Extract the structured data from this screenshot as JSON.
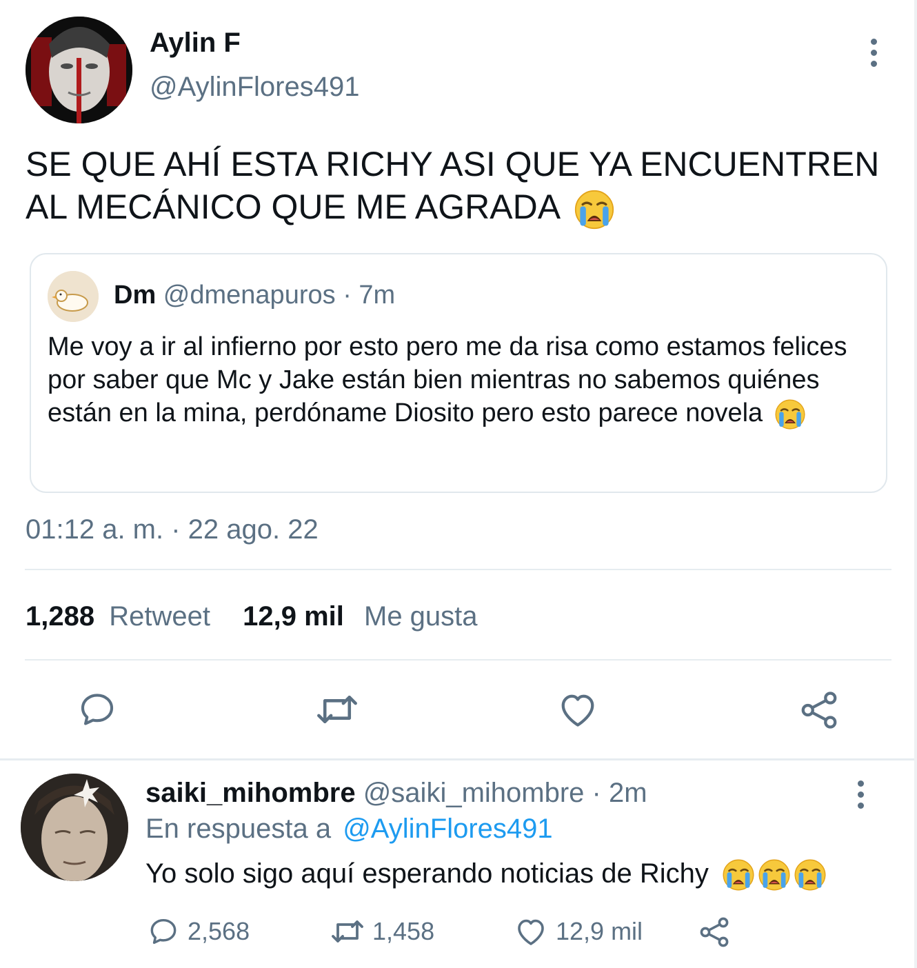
{
  "tweet": {
    "author_name": "Aylin F",
    "author_handle": "@AylinFlores491",
    "text": "SE QUE AHÍ ESTA RICHY ASI QUE YA ENCUENTREN AL MECÁNICO QUE ME AGRADA",
    "emoji": "loudly-crying-face",
    "timestamp": "01:12 a. m. · 22 ago. 22"
  },
  "quoted": {
    "author_name": "Dm",
    "author_handle": "@dmenapuros",
    "time": "· 7m",
    "text": "Me voy a ir al infierno por esto pero me da risa como estamos felices por saber que Mc y Jake están bien mientras no sabemos quiénes están en la mina, perdóname Diosito pero esto parece novela"
  },
  "stats": {
    "retweets_count": "1,288",
    "retweets_label": "Retweet",
    "likes_count": "12,9 mil",
    "likes_label": "Me gusta"
  },
  "actions": [
    "reply-icon",
    "retweet-icon",
    "heart-icon",
    "share-icon"
  ],
  "reply": {
    "author_name": "saiki_mihombre",
    "author_handle": "@saiki_mihombre",
    "time": "· 2m",
    "in_reply_prefix": "En respuesta a",
    "in_reply_handle": "@AylinFlores491",
    "text": "Yo solo sigo aquí esperando noticias de Richy",
    "reply_count": "2,568",
    "retweet_count": "1,458",
    "like_count": "12,9 mil"
  },
  "colors": {
    "text": "#0f1419",
    "secondary": "#5b7083",
    "link": "#1d9bf0",
    "divider": "#e6ecf0"
  }
}
